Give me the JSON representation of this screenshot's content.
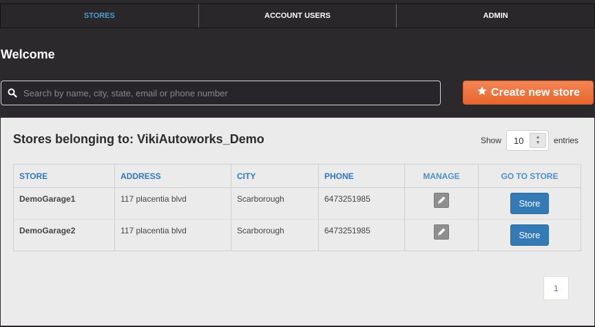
{
  "nav": {
    "tabs": [
      {
        "label": "STORES",
        "active": true
      },
      {
        "label": "ACCOUNT USERS",
        "active": false
      },
      {
        "label": "ADMIN",
        "active": false
      }
    ]
  },
  "header": {
    "welcome": "Welcome",
    "search_placeholder": "Search by name, city, state, email or phone number",
    "search_value": "",
    "create_label": "Create new store"
  },
  "panel": {
    "title": "Stores belonging to: VikiAutoworks_Demo",
    "show_label": "Show",
    "entries_value": "10",
    "entries_label": "entries",
    "columns": [
      "STORE",
      "ADDRESS",
      "CITY",
      "PHONE",
      "MANAGE",
      "GO TO STORE"
    ],
    "rows": [
      {
        "store": "DemoGarage1",
        "address": "117 placentia blvd",
        "city": "Scarborough",
        "phone": "6473251985",
        "action": "Store"
      },
      {
        "store": "DemoGarage2",
        "address": "117 placentia blvd",
        "city": "Scarborough",
        "phone": "6473251985",
        "action": "Store"
      }
    ],
    "page": "1"
  },
  "colors": {
    "accent": "#4a9fd6",
    "create_button": "#ef7441",
    "store_button": "#337ab7",
    "background": "#2c292d",
    "panel": "#ebebeb"
  },
  "icons": {
    "search": "search-icon",
    "create": "star-icon",
    "manage": "pencil-icon",
    "spinner": "sort-icon"
  }
}
